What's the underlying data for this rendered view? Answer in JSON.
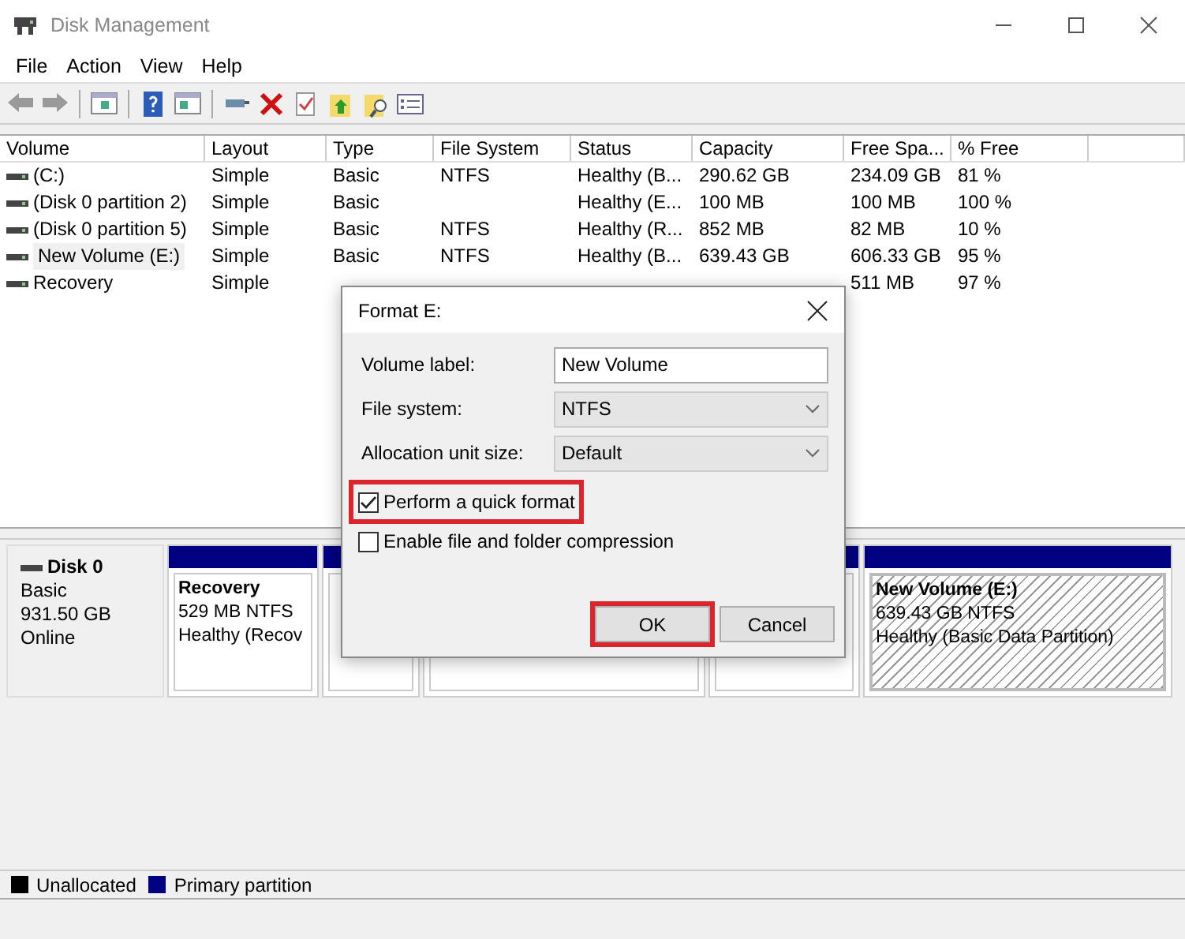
{
  "window": {
    "title": "Disk Management"
  },
  "menu": [
    "File",
    "Action",
    "View",
    "Help"
  ],
  "table": {
    "columns": [
      "Volume",
      "Layout",
      "Type",
      "File System",
      "Status",
      "Capacity",
      "Free Spa...",
      "% Free"
    ],
    "rows": [
      {
        "selected": false,
        "cells": [
          "(C:)",
          "Simple",
          "Basic",
          "NTFS",
          "Healthy (B...",
          "290.62 GB",
          "234.09 GB",
          "81 %"
        ]
      },
      {
        "selected": false,
        "cells": [
          "(Disk 0 partition 2)",
          "Simple",
          "Basic",
          "",
          "Healthy (E...",
          "100 MB",
          "100 MB",
          "100 %"
        ]
      },
      {
        "selected": false,
        "cells": [
          "(Disk 0 partition 5)",
          "Simple",
          "Basic",
          "NTFS",
          "Healthy (R...",
          "852 MB",
          "82 MB",
          "10 %"
        ]
      },
      {
        "selected": true,
        "cells": [
          "New Volume (E:)",
          "Simple",
          "Basic",
          "NTFS",
          "Healthy (B...",
          "639.43 GB",
          "606.33 GB",
          "95 %"
        ]
      },
      {
        "selected": false,
        "cells": [
          "Recovery",
          "Simple",
          "",
          "",
          "",
          "",
          "511 MB",
          "97 %"
        ]
      }
    ]
  },
  "disk": {
    "name": "Disk 0",
    "type": "Basic",
    "size": "931.50 GB",
    "state": "Online",
    "partitions": [
      {
        "kind": "primary",
        "name": "Recovery",
        "size": "529 MB NTFS",
        "status": "Healthy (Recov"
      },
      {
        "kind": "primary"
      },
      {
        "kind": "primary"
      },
      {
        "kind": "primary"
      },
      {
        "kind": "selected",
        "name": "New Volume  (E:)",
        "size": "639.43 GB NTFS",
        "status": "Healthy (Basic Data Partition)"
      }
    ]
  },
  "legend": [
    {
      "label": "Unallocated",
      "color": "#000000"
    },
    {
      "label": "Primary partition",
      "color": "#000080"
    }
  ],
  "dialog": {
    "title": "Format E:",
    "fields": [
      {
        "kind": "text",
        "label": "Volume label:",
        "value": "New Volume"
      },
      {
        "kind": "select",
        "label": "File system:",
        "value": "NTFS"
      },
      {
        "kind": "select",
        "label": "Allocation unit size:",
        "value": "Default"
      }
    ],
    "options": [
      {
        "label": "Perform a quick format",
        "checked": true,
        "highlighted": true
      },
      {
        "label": "Enable file and folder compression",
        "checked": false,
        "highlighted": false
      }
    ],
    "buttons": [
      {
        "label": "OK",
        "highlighted": true
      },
      {
        "label": "Cancel",
        "highlighted": false
      }
    ]
  }
}
